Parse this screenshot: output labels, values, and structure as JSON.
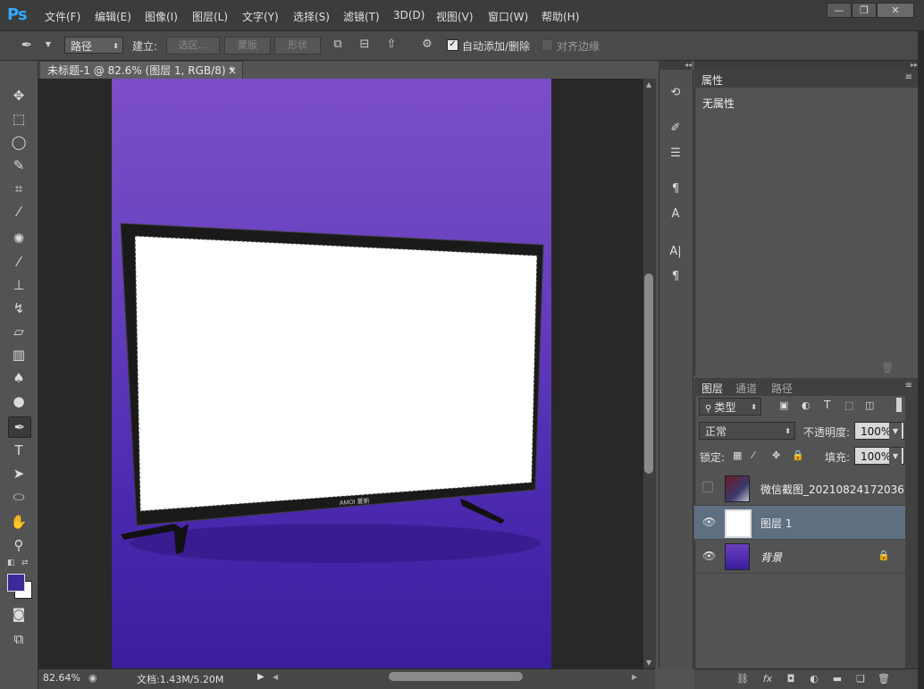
{
  "app": {
    "logo": "Ps"
  },
  "menu": [
    "文件(F)",
    "编辑(E)",
    "图像(I)",
    "图层(L)",
    "文字(Y)",
    "选择(S)",
    "滤镜(T)",
    "3D(D)",
    "视图(V)",
    "窗口(W)",
    "帮助(H)"
  ],
  "window_buttons": {
    "minimize": "—",
    "restore": "❐",
    "close": "✕"
  },
  "options": {
    "mode": "路径",
    "build_label": "建立:",
    "selection_btn": "选区...",
    "mask_btn": "蒙版",
    "shape_btn": "形状",
    "auto_add_delete": "自动添加/删除",
    "align_edges": "对齐边缘"
  },
  "document": {
    "tab_title": "未标题-1 @ 82.6% (图层 1, RGB/8) *",
    "tab_close": "×"
  },
  "canvas": {
    "tv_brand": "AMOI 夏新"
  },
  "status": {
    "zoom": "82.64%",
    "doc_info": "文档:1.43M/5.20M"
  },
  "properties": {
    "tab": "属性",
    "content": "无属性"
  },
  "layers_panel": {
    "tabs": [
      "图层",
      "通道",
      "路径"
    ],
    "filter_kind": "类型",
    "blend_mode": "正常",
    "opacity_label": "不透明度:",
    "opacity_value": "100%",
    "lock_label": "锁定:",
    "fill_label": "填充:",
    "fill_value": "100%",
    "layers": [
      {
        "name": "微信截图_20210824172036",
        "visible": false
      },
      {
        "name": "图层 1",
        "visible": true,
        "selected": true
      },
      {
        "name": "背景",
        "visible": true,
        "locked": true
      }
    ]
  },
  "colors": {
    "accent": "#31a8ff",
    "canvas_top": "#7c4ec8",
    "canvas_bottom": "#3a1e9c",
    "selected_row": "#5f6f82"
  }
}
